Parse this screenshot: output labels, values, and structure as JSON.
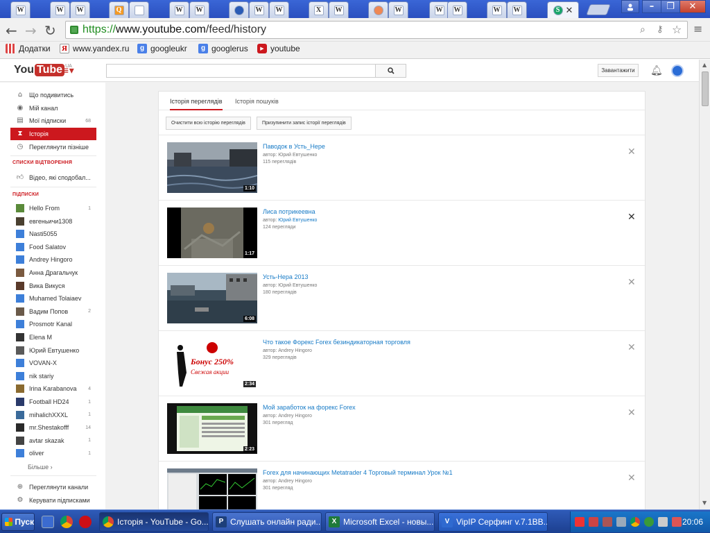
{
  "browser": {
    "tabs": [
      {
        "icon": "wikipedia-icon"
      },
      {
        "icon": "wikipedia-icon"
      },
      {
        "icon": "wikipedia-icon"
      },
      {
        "icon": "orange-app-icon"
      },
      {
        "icon": "blank-page-icon"
      },
      {
        "icon": "wikipedia-icon"
      },
      {
        "icon": "wikipedia-icon"
      },
      {
        "icon": "globe-icon"
      },
      {
        "icon": "wikipedia-icon"
      },
      {
        "icon": "wikipedia-icon"
      },
      {
        "icon": "x-logo-icon"
      },
      {
        "icon": "wikipedia-icon"
      },
      {
        "icon": "orange-circle-icon"
      },
      {
        "icon": "wikipedia-icon"
      },
      {
        "icon": "wikipedia-icon"
      },
      {
        "icon": "wikipedia-icon"
      },
      {
        "icon": "wikipedia-icon"
      },
      {
        "icon": "wikipedia-icon"
      },
      {
        "icon": "green-s-icon",
        "active": true
      }
    ],
    "url_protocol": "https://",
    "url_host": "www.youtube.com",
    "url_path": "/feed/history",
    "bookmarks": [
      {
        "label": "Додатки",
        "icon": "apps-grid-icon"
      },
      {
        "label": "www.yandex.ru",
        "icon": "yandex-icon"
      },
      {
        "label": "googleukr",
        "icon": "google-icon"
      },
      {
        "label": "googlerus",
        "icon": "google-icon"
      },
      {
        "label": "youtube",
        "icon": "youtube-icon"
      }
    ]
  },
  "youtube": {
    "logo_you": "You",
    "logo_tube": "Tube",
    "logo_country": "UA",
    "upload_label": "Завантажити",
    "sidebar": {
      "main": [
        {
          "label": "Що подивитись",
          "icon": "home-icon"
        },
        {
          "label": "Мій канал",
          "icon": "user-circle-icon"
        },
        {
          "label": "Мої підписки",
          "icon": "subscriptions-icon",
          "count": "68"
        },
        {
          "label": "Історія",
          "icon": "hourglass-icon",
          "active": true
        },
        {
          "label": "Переглянути пізніше",
          "icon": "clock-icon"
        }
      ],
      "playlists_heading": "СПИСКИ ВІДТВОРЕННЯ",
      "playlists": [
        {
          "label": "Відео, які сподобал...",
          "icon": "thumb-up-icon"
        }
      ],
      "subscriptions_heading": "ПІДПИСКИ",
      "subscriptions": [
        {
          "label": "Hello From",
          "count": "1",
          "color": "#5a8a3a"
        },
        {
          "label": "евгеньичи1308",
          "count": "",
          "color": "#4a4030"
        },
        {
          "label": "Nasti5055",
          "count": "",
          "color": "#3d7fd9"
        },
        {
          "label": "Food Salatov",
          "count": "",
          "color": "#3d7fd9"
        },
        {
          "label": "Andrey Hingoro",
          "count": "",
          "color": "#3d7fd9"
        },
        {
          "label": "Анна Драгальчук",
          "count": "",
          "color": "#7a5a40"
        },
        {
          "label": "Вика Викуся",
          "count": "",
          "color": "#5a3a2a"
        },
        {
          "label": "Muhamed Tolaiaev",
          "count": "",
          "color": "#3d7fd9"
        },
        {
          "label": "Вадим Попов",
          "count": "2",
          "color": "#6a5a4a"
        },
        {
          "label": "Prosmotr Kanal",
          "count": "",
          "color": "#3d7fd9"
        },
        {
          "label": "Elena M",
          "count": "",
          "color": "#333333"
        },
        {
          "label": "Юрий Евтушенко",
          "count": "",
          "color": "#5a5a5a"
        },
        {
          "label": "VOVAN-X",
          "count": "",
          "color": "#3d7fd9"
        },
        {
          "label": "nik stariy",
          "count": "",
          "color": "#3d7fd9"
        },
        {
          "label": "Irina Karabanova",
          "count": "4",
          "color": "#8a6a30"
        },
        {
          "label": "Football HD24",
          "count": "1",
          "color": "#2a3a6a"
        },
        {
          "label": "mihalichXXXL",
          "count": "1",
          "color": "#3a6a9a"
        },
        {
          "label": "mr.Shestakofff",
          "count": "14",
          "color": "#2a2a2a"
        },
        {
          "label": "avtar skazak",
          "count": "1",
          "color": "#444444"
        },
        {
          "label": "oliver",
          "count": "1",
          "color": "#3d7fd9"
        }
      ],
      "more_label": "Більше ›",
      "bottom": [
        {
          "label": "Переглянути канали",
          "icon": "plus-circle-icon"
        },
        {
          "label": "Керувати підписками",
          "icon": "gear-icon"
        }
      ]
    },
    "tabs": [
      {
        "label": "Історія переглядів",
        "selected": true
      },
      {
        "label": "Історія пошуків",
        "selected": false
      }
    ],
    "actions": {
      "clear": "Очистити всю історію переглядів",
      "pause": "Призупинити запис історії переглядів"
    },
    "videos": [
      {
        "title": "Паводок в Усть_Нере",
        "author_prefix": "автор:",
        "author": "Юрий Евтушенко",
        "author_link": false,
        "views": "115 переглядів",
        "duration": "1:10",
        "thumb": "flood"
      },
      {
        "title": "Лиса потрикеевна",
        "author_prefix": "автор:",
        "author": "Юрий Евтушенко",
        "author_link": true,
        "views": "124 перегляди",
        "duration": "1:17",
        "thumb": "fox"
      },
      {
        "title": "Усть-Нера 2013",
        "author_prefix": "автор:",
        "author": "Юрий Евтушенко",
        "author_link": false,
        "views": "180 переглядів",
        "duration": "6:08",
        "thumb": "town"
      },
      {
        "title": "Что такое Форекс Forex безиндикаторная торговля",
        "author_prefix": "автор:",
        "author": "Andrey Hingoro",
        "author_link": false,
        "views": "329 переглядів",
        "duration": "2:34",
        "thumb": "forex"
      },
      {
        "title": "Мой заработок на форекс Forex",
        "author_prefix": "автор:",
        "author": "Andrey Hingoro",
        "author_link": false,
        "views": "301 перегляд",
        "duration": "2:23",
        "thumb": "web"
      },
      {
        "title": "Forex для начинающих Metatrader 4 Торговый терминал Урок №1",
        "author_prefix": "автор:",
        "author": "Andrey Hingoro",
        "author_link": false,
        "views": "301 перегляд",
        "duration": "",
        "thumb": "terminal"
      }
    ],
    "forex_thumb_text": [
      "Бонус 250%",
      "Свежая акции"
    ]
  },
  "taskbar": {
    "start_label": "Пуск",
    "tasks": [
      {
        "label": "Історія - YouTube - Go...",
        "icon": "chrome-icon",
        "active": true
      },
      {
        "label": "Слушать онлайн ради...",
        "icon": "p-app-icon",
        "active": false
      },
      {
        "label": "Microsoft Excel - новы...",
        "icon": "excel-icon",
        "active": false
      },
      {
        "label": "VipIP Серфинг  v.7.1BB...",
        "icon": "vipip-icon",
        "active": false
      }
    ],
    "clock": "20:06"
  }
}
